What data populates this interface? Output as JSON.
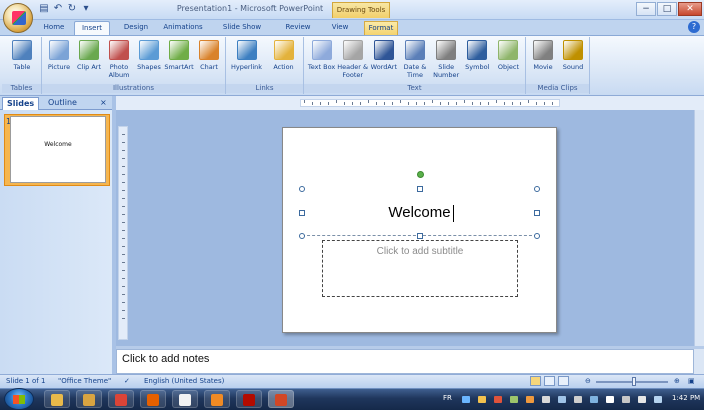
{
  "window": {
    "title": "Presentation1 - Microsoft PowerPoint",
    "contextual_tab": "Drawing Tools",
    "controls": {
      "minimize": "−",
      "maximize": "□",
      "close": "✕"
    }
  },
  "quick_access": {
    "save_icon": "save-icon",
    "undo_icon": "undo-icon",
    "redo_icon": "redo-icon",
    "more": "▾"
  },
  "tabs": [
    {
      "label": "Home"
    },
    {
      "label": "Insert",
      "active": true
    },
    {
      "label": "Design"
    },
    {
      "label": "Animations"
    },
    {
      "label": "Slide Show"
    },
    {
      "label": "Review"
    },
    {
      "label": "View"
    },
    {
      "label": "Format",
      "contextual": true
    }
  ],
  "ribbon": {
    "groups": [
      {
        "label": "Tables",
        "buttons": [
          {
            "label": "Table",
            "icon": "table-icon",
            "color": "#4f81bd"
          }
        ]
      },
      {
        "label": "Illustrations",
        "buttons": [
          {
            "label": "Picture",
            "icon": "picture-icon",
            "color": "#7ba3d6"
          },
          {
            "label": "Clip Art",
            "icon": "clip-art-icon",
            "color": "#6aa84f"
          },
          {
            "label": "Photo Album",
            "icon": "photo-album-icon",
            "color": "#c0504d"
          },
          {
            "label": "Shapes",
            "icon": "shapes-icon",
            "color": "#5b9bd5"
          },
          {
            "label": "SmartArt",
            "icon": "smartart-icon",
            "color": "#70ad47"
          },
          {
            "label": "Chart",
            "icon": "chart-icon",
            "color": "#d9822b"
          }
        ]
      },
      {
        "label": "Links",
        "buttons": [
          {
            "label": "Hyperlink",
            "icon": "hyperlink-icon",
            "color": "#3d7fc1"
          },
          {
            "label": "Action",
            "icon": "action-icon",
            "color": "#e3b23c"
          }
        ]
      },
      {
        "label": "Text",
        "buttons": [
          {
            "label": "Text Box",
            "icon": "text-box-icon",
            "color": "#8eaadb"
          },
          {
            "label": "Header & Footer",
            "icon": "header-footer-icon",
            "color": "#a5a5a5"
          },
          {
            "label": "WordArt",
            "icon": "wordart-icon",
            "color": "#2f5597"
          },
          {
            "label": "Date & Time",
            "icon": "date-time-icon",
            "color": "#5b7fb8"
          },
          {
            "label": "Slide Number",
            "icon": "slide-number-icon",
            "color": "#7f7f7f"
          },
          {
            "label": "Symbol",
            "icon": "symbol-icon",
            "color": "#2e5e9e"
          },
          {
            "label": "Object",
            "icon": "object-icon",
            "color": "#8fb56b"
          }
        ]
      },
      {
        "label": "Media Clips",
        "buttons": [
          {
            "label": "Movie",
            "icon": "movie-icon",
            "color": "#808080"
          },
          {
            "label": "Sound",
            "icon": "sound-icon",
            "color": "#bf9000"
          }
        ]
      }
    ]
  },
  "slides_pane": {
    "tabs": [
      "Slides",
      "Outline"
    ],
    "close": "×",
    "thumbnails": [
      {
        "number": "1",
        "text": "Welcome"
      }
    ]
  },
  "slide": {
    "title": "Welcome",
    "subtitle_placeholder": "Click to add subtitle"
  },
  "notes": {
    "placeholder": "Click to add notes"
  },
  "status_bar": {
    "slide_info": "Slide 1 of 1",
    "theme": "\"Office Theme\"",
    "language": "English (United States)"
  },
  "taskbar": {
    "language_indicator": "FR",
    "clock": "1:42 PM",
    "apps": [
      {
        "icon": "folder-icon",
        "color": "#e8b94a"
      },
      {
        "icon": "explorer-icon",
        "color": "#d9a441"
      },
      {
        "icon": "chrome-icon",
        "color": "#db4437"
      },
      {
        "icon": "firefox-icon",
        "color": "#e66000"
      },
      {
        "icon": "media-icon",
        "color": "#f2f2f2"
      },
      {
        "icon": "vlc-icon",
        "color": "#f08a24"
      },
      {
        "icon": "pdf-icon",
        "color": "#b30b00"
      },
      {
        "icon": "powerpoint-icon",
        "color": "#d24726"
      }
    ]
  },
  "colors": {
    "accent": "#15428b",
    "format_tab": "#f4d36f",
    "selected_thumb": "#f6b64f"
  }
}
